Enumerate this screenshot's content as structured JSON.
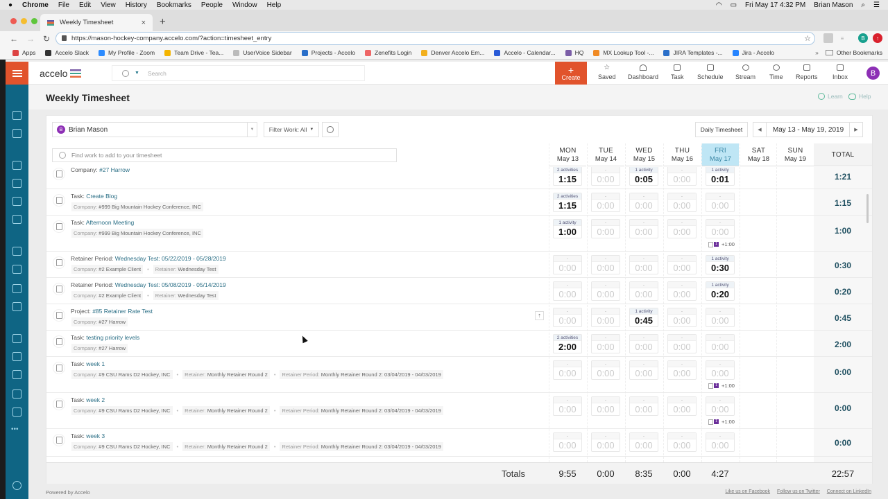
{
  "mac_menu": {
    "apple": "",
    "items": [
      "Chrome",
      "File",
      "Edit",
      "View",
      "History",
      "Bookmarks",
      "People",
      "Window",
      "Help"
    ],
    "clock": "Fri May 17  4:32 PM",
    "user": "Brian Mason"
  },
  "browser": {
    "tab_title": "Weekly Timesheet",
    "url": "https://mason-hockey-company.accelo.com/?action=timesheet_entry",
    "profile_initial": "B",
    "bookmarks": [
      {
        "label": "Apps",
        "color": "#d44"
      },
      {
        "label": "Accelo Slack",
        "color": "#333"
      },
      {
        "label": "My Profile - Zoom",
        "color": "#2d8cff"
      },
      {
        "label": "Team Drive - Tea...",
        "color": "#f4b400"
      },
      {
        "label": "UserVoice Sidebar",
        "color": "#bbb"
      },
      {
        "label": "Projects - Accelo",
        "color": "#2a6fc9"
      },
      {
        "label": "Zenefits Login",
        "color": "#e66"
      },
      {
        "label": "Denver Accelo Em...",
        "color": "#f2b01e"
      },
      {
        "label": "Accelo - Calendar...",
        "color": "#2a5bd7"
      },
      {
        "label": "HQ",
        "color": "#7b5ea7"
      },
      {
        "label": "MX Lookup Tool -...",
        "color": "#f08a24"
      },
      {
        "label": "JIRA Templates -...",
        "color": "#2a6fc9"
      },
      {
        "label": "Jira - Accelo",
        "color": "#2684ff"
      }
    ],
    "other_bookmarks": "Other Bookmarks"
  },
  "app": {
    "logo": "accelo",
    "search_placeholder": "Search",
    "create_label": "Create",
    "nav": [
      "Saved",
      "Dashboard",
      "Task",
      "Schedule",
      "Stream",
      "Time",
      "Reports",
      "Inbox"
    ],
    "avatar_initial": "B",
    "sidebar_icons": [
      "companies-icon",
      "contacts-icon",
      "sales-icon",
      "projects-icon",
      "tickets-icon",
      "retainers-icon",
      "invoices-icon",
      "expenses-icon",
      "quotes-icon",
      "purchases-icon",
      "inbox-icon",
      "assets-icon",
      "requests-icon",
      "contracts-icon",
      "forms-icon",
      "more-icon"
    ]
  },
  "page": {
    "title": "Weekly Timesheet",
    "learn": "Learn",
    "help": "Help"
  },
  "toolbar": {
    "user_initial": "B",
    "user_name": "Brian Mason",
    "filter": "Filter Work: All",
    "daily_button": "Daily Timesheet",
    "date_range": "May 13 - May 19, 2019",
    "find_placeholder": "Find work to add to your timesheet"
  },
  "days": [
    {
      "day": "MON",
      "date": "May 13"
    },
    {
      "day": "TUE",
      "date": "May 14"
    },
    {
      "day": "WED",
      "date": "May 15"
    },
    {
      "day": "THU",
      "date": "May 16"
    },
    {
      "day": "FRI",
      "date": "May 17",
      "today": true
    },
    {
      "day": "SAT",
      "date": "May 18"
    },
    {
      "day": "SUN",
      "date": "May 19"
    }
  ],
  "total_header": "TOTAL",
  "rows": [
    {
      "type": "Company: ",
      "name": "#27 Harrow",
      "meta": [],
      "icon": "company-icon",
      "cells": [
        [
          "2 activities",
          "1:15"
        ],
        [
          "-",
          "0:00"
        ],
        [
          "1 activity",
          "0:05"
        ],
        [
          "-",
          "0:00"
        ],
        [
          "1 activity",
          "0:01"
        ]
      ],
      "addon": null,
      "total": "1:21"
    },
    {
      "type": "Task: ",
      "name": "Create Blog",
      "meta": [
        [
          "Company: ",
          "#999 Big Mountain Hockey Conference, INC"
        ]
      ],
      "icon": "task-icon",
      "cells": [
        [
          "2 activities",
          "1:15"
        ],
        [
          "-",
          "0:00"
        ],
        [
          "-",
          "0:00"
        ],
        [
          "-",
          "0:00"
        ],
        [
          "-",
          "0:00"
        ]
      ],
      "addon": null,
      "total": "1:15"
    },
    {
      "type": "Task: ",
      "name": "Afternoon Meeting",
      "meta": [
        [
          "Company: ",
          "#999 Big Mountain Hockey Conference, INC"
        ]
      ],
      "icon": "task-icon",
      "cells": [
        [
          "1 activity",
          "1:00"
        ],
        [
          "-",
          "0:00"
        ],
        [
          "-",
          "0:00"
        ],
        [
          "-",
          "0:00"
        ],
        [
          "-",
          "0:00"
        ]
      ],
      "addon": {
        "count": "1",
        "value": "+1:00"
      },
      "total": "1:00"
    },
    {
      "type": "Retainer Period: ",
      "name": "Wednesday Test: 05/22/2019 - 05/28/2019",
      "meta": [
        [
          "Company: ",
          "#2 Example Client"
        ],
        [
          "Retainer: ",
          "Wednesday Test"
        ]
      ],
      "icon": "retainer-period-icon",
      "cells": [
        [
          "-",
          "0:00"
        ],
        [
          "-",
          "0:00"
        ],
        [
          "-",
          "0:00"
        ],
        [
          "-",
          "0:00"
        ],
        [
          "1 activity",
          "0:30"
        ]
      ],
      "addon": null,
      "total": "0:30"
    },
    {
      "type": "Retainer Period: ",
      "name": "Wednesday Test: 05/08/2019 - 05/14/2019",
      "meta": [
        [
          "Company: ",
          "#2 Example Client"
        ],
        [
          "Retainer: ",
          "Wednesday Test"
        ]
      ],
      "icon": "retainer-period-icon",
      "cells": [
        [
          "-",
          "0:00"
        ],
        [
          "-",
          "0:00"
        ],
        [
          "-",
          "0:00"
        ],
        [
          "-",
          "0:00"
        ],
        [
          "1 activity",
          "0:20"
        ]
      ],
      "addon": null,
      "total": "0:20"
    },
    {
      "type": "Project: ",
      "name": "#85 Retainer Rate Test",
      "meta": [
        [
          "Company: ",
          "#27 Harrow"
        ]
      ],
      "icon": "project-icon",
      "cells": [
        [
          "-",
          "0:00"
        ],
        [
          "-",
          "0:00"
        ],
        [
          "1 activity",
          "0:45"
        ],
        [
          "-",
          "0:00"
        ],
        [
          "-",
          "0:00"
        ]
      ],
      "addon": null,
      "total": "0:45",
      "pin": true
    },
    {
      "type": "Task: ",
      "name": "testing priority levels",
      "meta": [
        [
          "Company: ",
          "#27 Harrow"
        ]
      ],
      "icon": "task-icon",
      "cells": [
        [
          "2 activities",
          "2:00"
        ],
        [
          "-",
          "0:00"
        ],
        [
          "-",
          "0:00"
        ],
        [
          "-",
          "0:00"
        ],
        [
          "-",
          "0:00"
        ]
      ],
      "addon": null,
      "total": "2:00"
    },
    {
      "type": "Task: ",
      "name": "week 1",
      "meta": [
        [
          "Company: ",
          "#9 CSU Rams D2 Hockey, INC"
        ],
        [
          "Retainer: ",
          "Monthly Retainer Round 2"
        ],
        [
          "Retainer Period: ",
          "Monthly Retainer Round 2: 03/04/2019 - 04/03/2019"
        ]
      ],
      "icon": "retainer-task-icon",
      "cells": [
        [
          "-",
          "0:00"
        ],
        [
          "-",
          "0:00"
        ],
        [
          "-",
          "0:00"
        ],
        [
          "-",
          "0:00"
        ],
        [
          "-",
          "0:00"
        ]
      ],
      "addon": {
        "count": "1",
        "value": "+1:00"
      },
      "total": "0:00"
    },
    {
      "type": "Task: ",
      "name": "week 2",
      "meta": [
        [
          "Company: ",
          "#9 CSU Rams D2 Hockey, INC"
        ],
        [
          "Retainer: ",
          "Monthly Retainer Round 2"
        ],
        [
          "Retainer Period: ",
          "Monthly Retainer Round 2: 03/04/2019 - 04/03/2019"
        ]
      ],
      "icon": "retainer-task-icon",
      "cells": [
        [
          "-",
          "0:00"
        ],
        [
          "-",
          "0:00"
        ],
        [
          "-",
          "0:00"
        ],
        [
          "-",
          "0:00"
        ],
        [
          "-",
          "0:00"
        ]
      ],
      "addon": {
        "count": "1",
        "value": "+1:00"
      },
      "total": "0:00"
    },
    {
      "type": "Task: ",
      "name": "week 3",
      "meta": [
        [
          "Company: ",
          "#9 CSU Rams D2 Hockey, INC"
        ],
        [
          "Retainer: ",
          "Monthly Retainer Round 2"
        ],
        [
          "Retainer Period: ",
          "Monthly Retainer Round 2: 03/04/2019 - 04/03/2019"
        ]
      ],
      "icon": "retainer-task-icon",
      "cells": [
        [
          "-",
          "0:00"
        ],
        [
          "-",
          "0:00"
        ],
        [
          "-",
          "0:00"
        ],
        [
          "-",
          "0:00"
        ],
        [
          "-",
          "0:00"
        ]
      ],
      "addon": null,
      "total": "0:00"
    }
  ],
  "totals": {
    "label": "Totals",
    "days": [
      "9:55",
      "0:00",
      "8:35",
      "0:00",
      "4:27",
      "",
      ""
    ],
    "grand": "22:57"
  },
  "footer": {
    "powered": "Powered by Accelo",
    "social": [
      "Like us on Facebook",
      "Follow us on Twitter",
      "Connect on LinkedIn"
    ]
  }
}
